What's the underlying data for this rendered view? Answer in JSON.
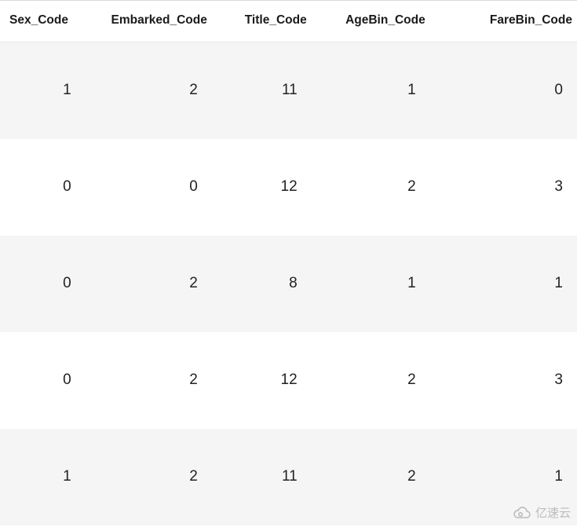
{
  "chart_data": {
    "type": "table",
    "title": "",
    "columns": [
      "Sex_Code",
      "Embarked_Code",
      "Title_Code",
      "AgeBin_Code",
      "FareBin_Code"
    ],
    "rows": [
      [
        1,
        2,
        11,
        1,
        0
      ],
      [
        0,
        0,
        12,
        2,
        3
      ],
      [
        0,
        2,
        8,
        1,
        1
      ],
      [
        0,
        2,
        12,
        2,
        3
      ],
      [
        1,
        2,
        11,
        2,
        1
      ]
    ]
  },
  "watermark": {
    "text": "亿速云"
  }
}
